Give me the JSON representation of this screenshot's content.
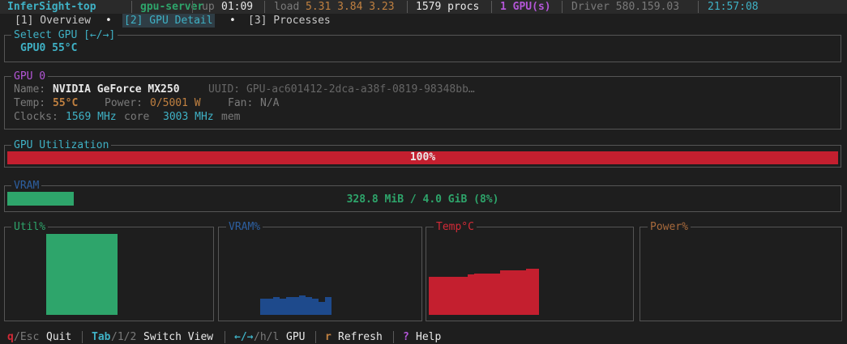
{
  "header": {
    "app_name": "InferSight-top",
    "host": "gpu-server",
    "uptime_label": "up",
    "uptime_value": "01:09",
    "load_label": "load",
    "load_values": "5.31 3.84 3.23",
    "procs": "1579 procs",
    "gpus": "1 GPU(s)",
    "driver": "Driver 580.159.03",
    "clock": "21:57:08"
  },
  "tabs": [
    {
      "label": "[1] Overview",
      "active": false
    },
    {
      "label": "[2] GPU Detail",
      "active": true
    },
    {
      "label": "[3] Processes",
      "active": false
    }
  ],
  "tab_dot": "•",
  "select_gpu": {
    "title": "Select GPU [←/→]",
    "value": "GPU0 55°C"
  },
  "gpu_info": {
    "title": "GPU 0",
    "name_label": "Name:",
    "name_value": "NVIDIA GeForce MX250",
    "uuid": "UUID: GPU-ac601412-2dca-a38f-0819-98348bb…",
    "temp_label": "Temp:",
    "temp_value": "55°C",
    "power_label": "Power:",
    "power_value": "0/5001 W",
    "fan_label": "Fan:",
    "fan_value": "N/A",
    "clocks_label": "Clocks:",
    "core_clock": "1569 MHz",
    "core_label": "core",
    "mem_clock": "3003 MHz",
    "mem_label": "mem"
  },
  "utilization": {
    "title": "GPU Utilization",
    "value_text": "100%",
    "fraction": 1.0,
    "color": "#c41f2f"
  },
  "vram": {
    "title": "VRAM",
    "value_text": "328.8 MiB / 4.0 GiB (8%)",
    "fraction": 0.08,
    "color": "#2ea56b"
  },
  "charts": [
    {
      "title": "Util%",
      "color": "#2ea56b",
      "title_color": "#2ea56b",
      "values": [
        100,
        100,
        100,
        100,
        100,
        100,
        100,
        100,
        100,
        100,
        100
      ]
    },
    {
      "title": "VRAM%",
      "color": "#1e4a8c",
      "title_color": "#2d5fa0",
      "values": [
        20,
        20,
        22,
        20,
        22,
        22,
        24,
        22,
        20,
        16,
        22
      ]
    },
    {
      "title": "Temp°C",
      "color": "#c41f2f",
      "title_color": "#d22a37",
      "values": [
        47,
        47,
        47,
        47,
        47,
        47,
        50,
        51,
        51,
        51,
        51,
        55,
        55,
        55,
        55,
        57,
        57
      ]
    },
    {
      "title": "Power%",
      "color": "#c08040",
      "title_color": "#a86a3c",
      "values": []
    }
  ],
  "footer": [
    {
      "key": "q",
      "rest": "/Esc",
      "label": "Quit"
    },
    {
      "key": "Tab",
      "rest": "/1/2",
      "label": "Switch View"
    },
    {
      "key": "←/→",
      "rest": "/h/l",
      "label": "GPU"
    },
    {
      "key": "r",
      "rest": "",
      "label": "Refresh"
    },
    {
      "key": "?",
      "rest": "",
      "label": "Help"
    }
  ]
}
